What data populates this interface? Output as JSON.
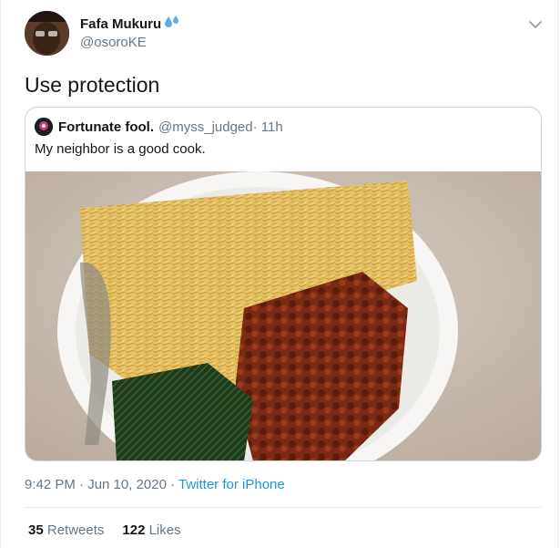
{
  "tweet": {
    "author_name": "Fafa Mukuru",
    "author_handle": "@osoroKE",
    "text": "Use protection",
    "timestamp": "9:42 PM · Jun 10, 2020 · ",
    "source": "Twitter for iPhone",
    "retweets_count": "35",
    "retweets_label": "Retweets",
    "likes_count": "122",
    "likes_label": "Likes"
  },
  "quote": {
    "author_name": "Fortunate fool.",
    "author_handle": "@myss_judged",
    "time": " · 11h",
    "text": "My neighbor is a good cook."
  },
  "icons": {
    "name_emoji": "sweat-droplets-icon",
    "menu": "chevron-down-icon"
  },
  "colors": {
    "link": "#1b95e0",
    "secondary_text": "#657786",
    "border": "#ccd6dd"
  }
}
